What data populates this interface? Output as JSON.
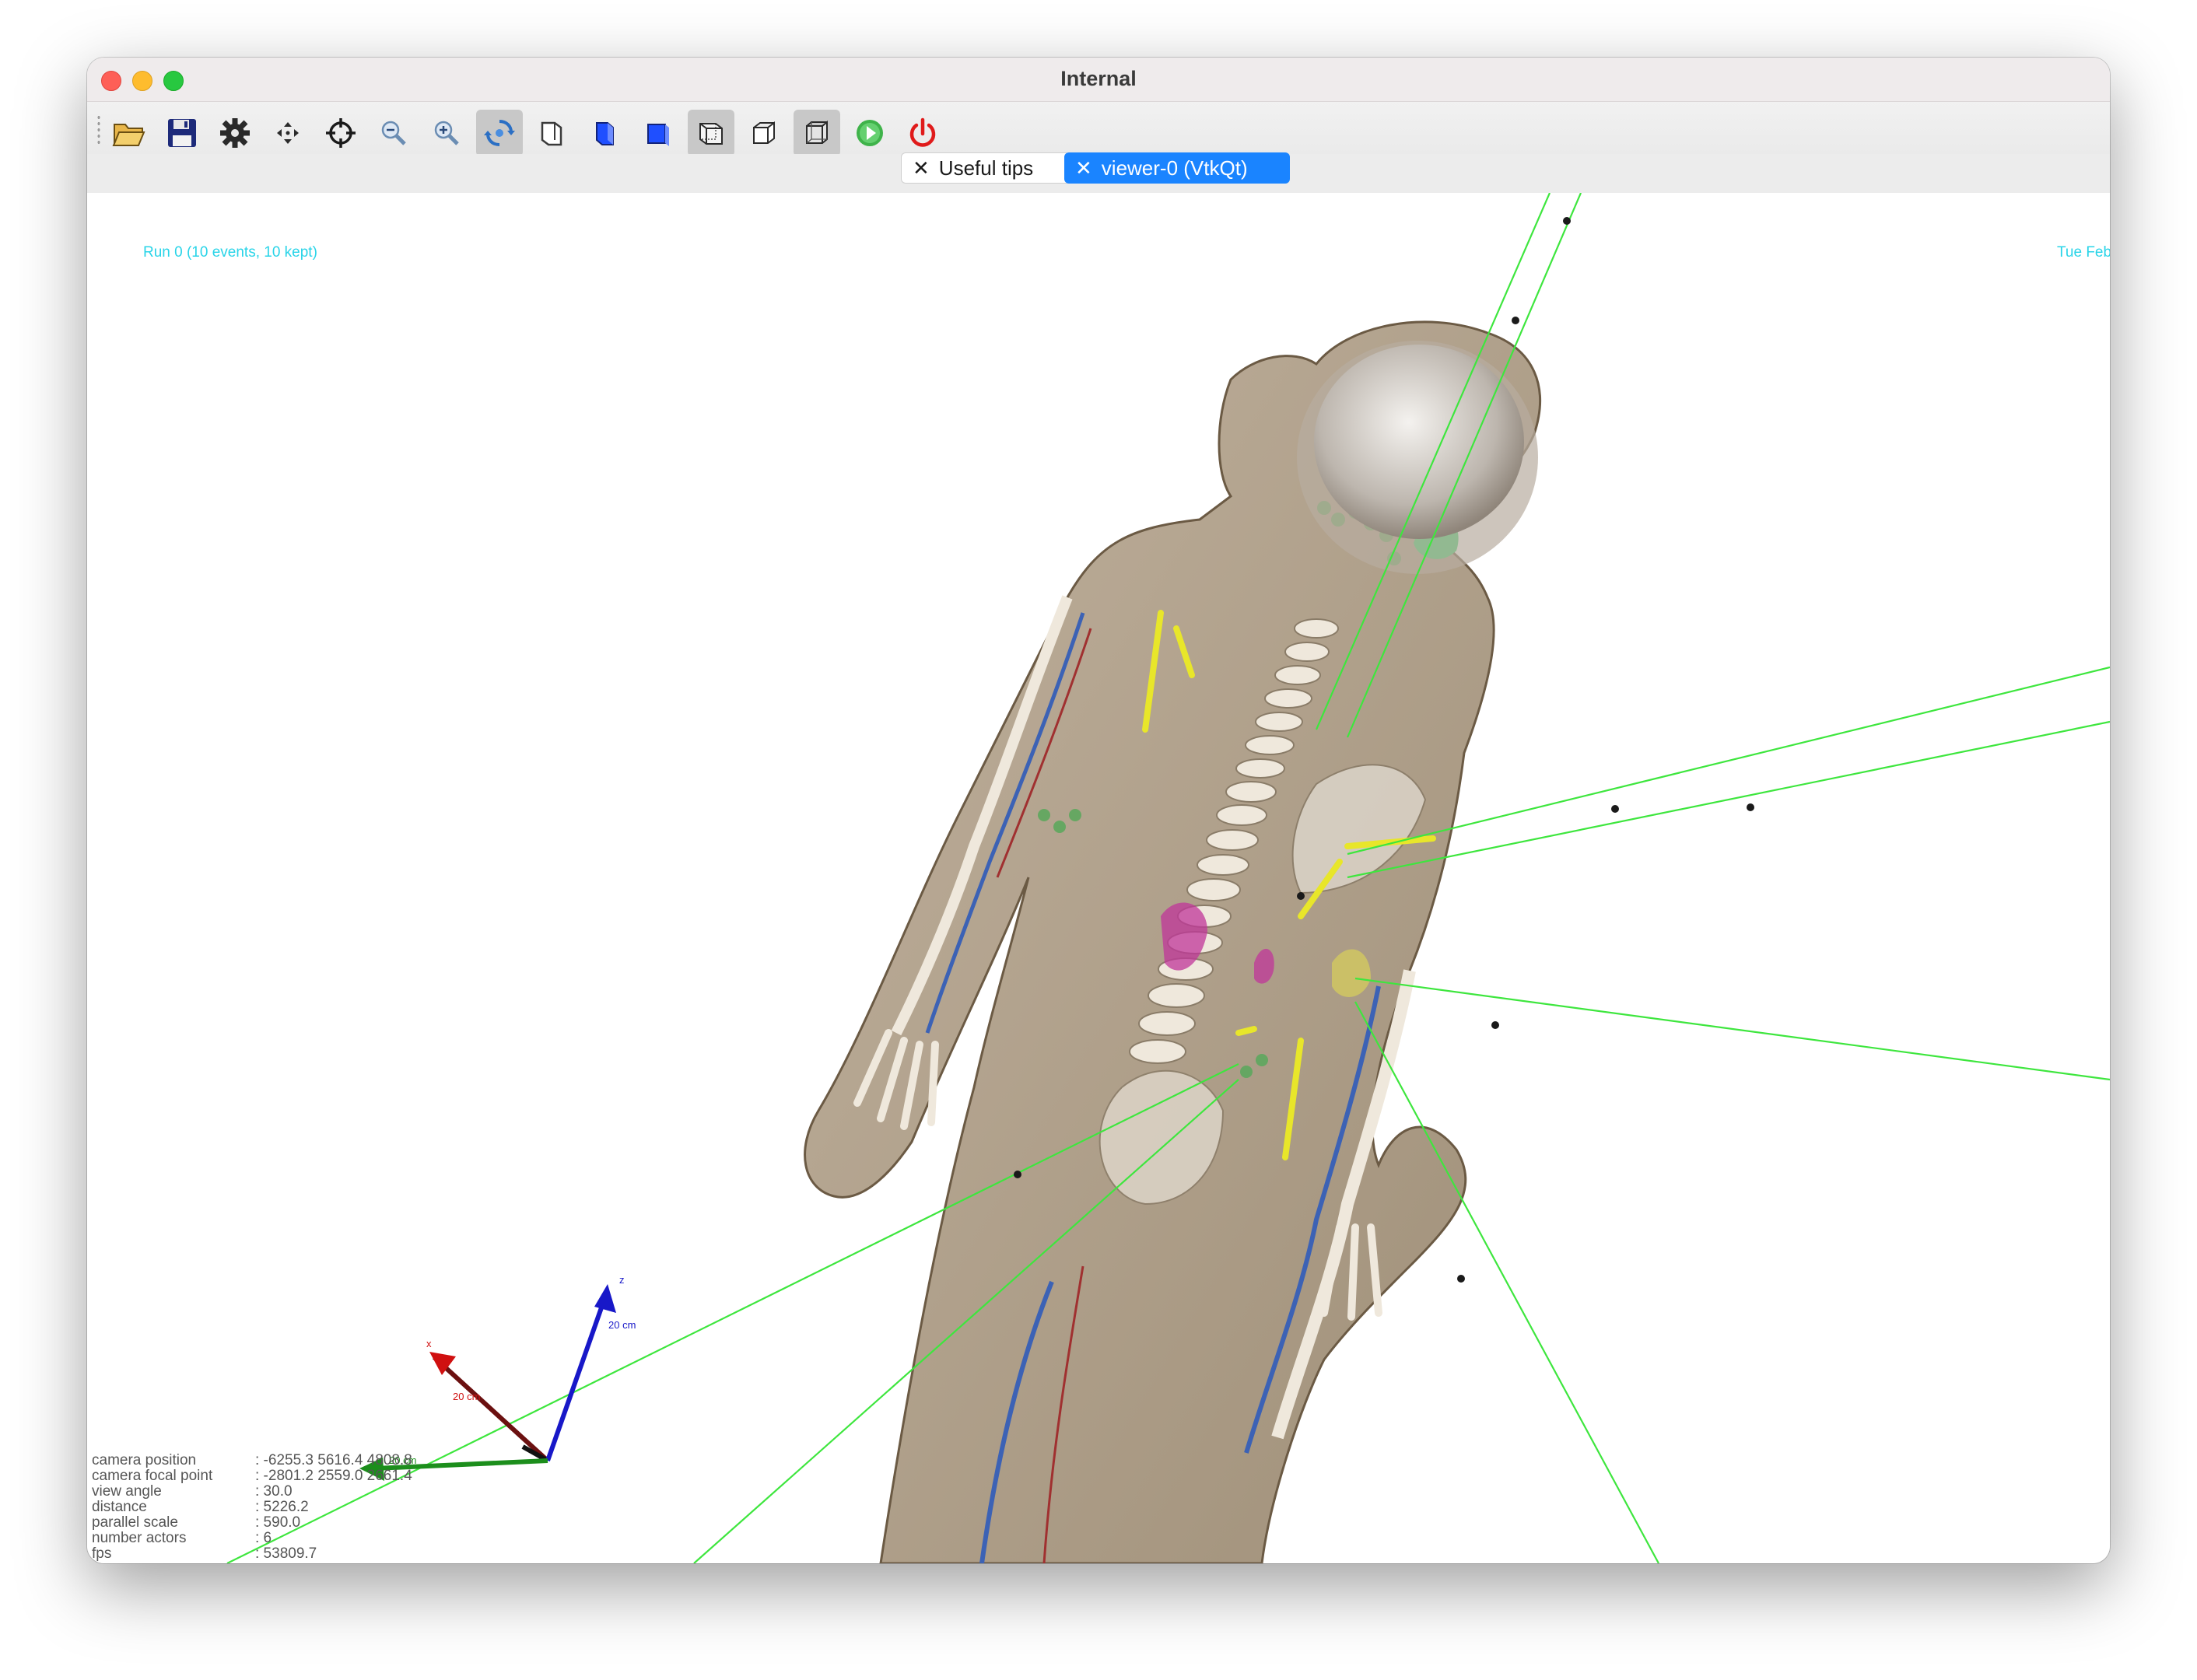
{
  "window": {
    "title": "Internal"
  },
  "toolbar": {
    "buttons": [
      {
        "name": "open-folder-icon"
      },
      {
        "name": "save-icon"
      },
      {
        "name": "settings-gear-icon"
      },
      {
        "name": "move-icon"
      },
      {
        "name": "target-crosshair-icon"
      },
      {
        "name": "zoom-out-icon"
      },
      {
        "name": "zoom-in-icon"
      },
      {
        "name": "rotate-view-icon"
      },
      {
        "name": "view-side-outline-icon"
      },
      {
        "name": "view-side-blue-icon"
      },
      {
        "name": "view-front-blue-icon"
      },
      {
        "name": "perspective-box-icon"
      },
      {
        "name": "orthographic-box-icon"
      },
      {
        "name": "wireframe-box-icon"
      },
      {
        "name": "run-play-icon"
      },
      {
        "name": "power-exit-icon"
      }
    ]
  },
  "tabs": [
    {
      "label": "Useful tips",
      "close": "✕"
    },
    {
      "label": "viewer-0 (VtkQt)",
      "close": "✕"
    }
  ],
  "viewer": {
    "run_label": "Run 0 (10 events, 10 kept)",
    "date_label": "Tue Feb",
    "axes": {
      "x": "x",
      "y": "y",
      "z": "z",
      "scale_x": "20 cm",
      "scale_y": "20 cm",
      "scale_z": "20 cm"
    },
    "camera_info": [
      {
        "key": "camera position",
        "value": ": -6255.3 5616.4 4808.8"
      },
      {
        "key": "camera focal point",
        "value": ": -2801.2 2559.0 2661.4"
      },
      {
        "key": "view angle",
        "value": ": 30.0"
      },
      {
        "key": "distance",
        "value": ": 5226.2"
      },
      {
        "key": "parallel scale",
        "value": ": 590.0"
      },
      {
        "key": "number actors",
        "value": ": 6"
      },
      {
        "key": "fps",
        "value": ": 53809.7"
      }
    ]
  },
  "colors": {
    "track_green": "#3ee63e",
    "label_cyan": "#29d4e8",
    "tab_active": "#1a84ff",
    "axis_x": "#d01010",
    "axis_y": "#1c8e1c",
    "axis_z": "#1818c8"
  }
}
